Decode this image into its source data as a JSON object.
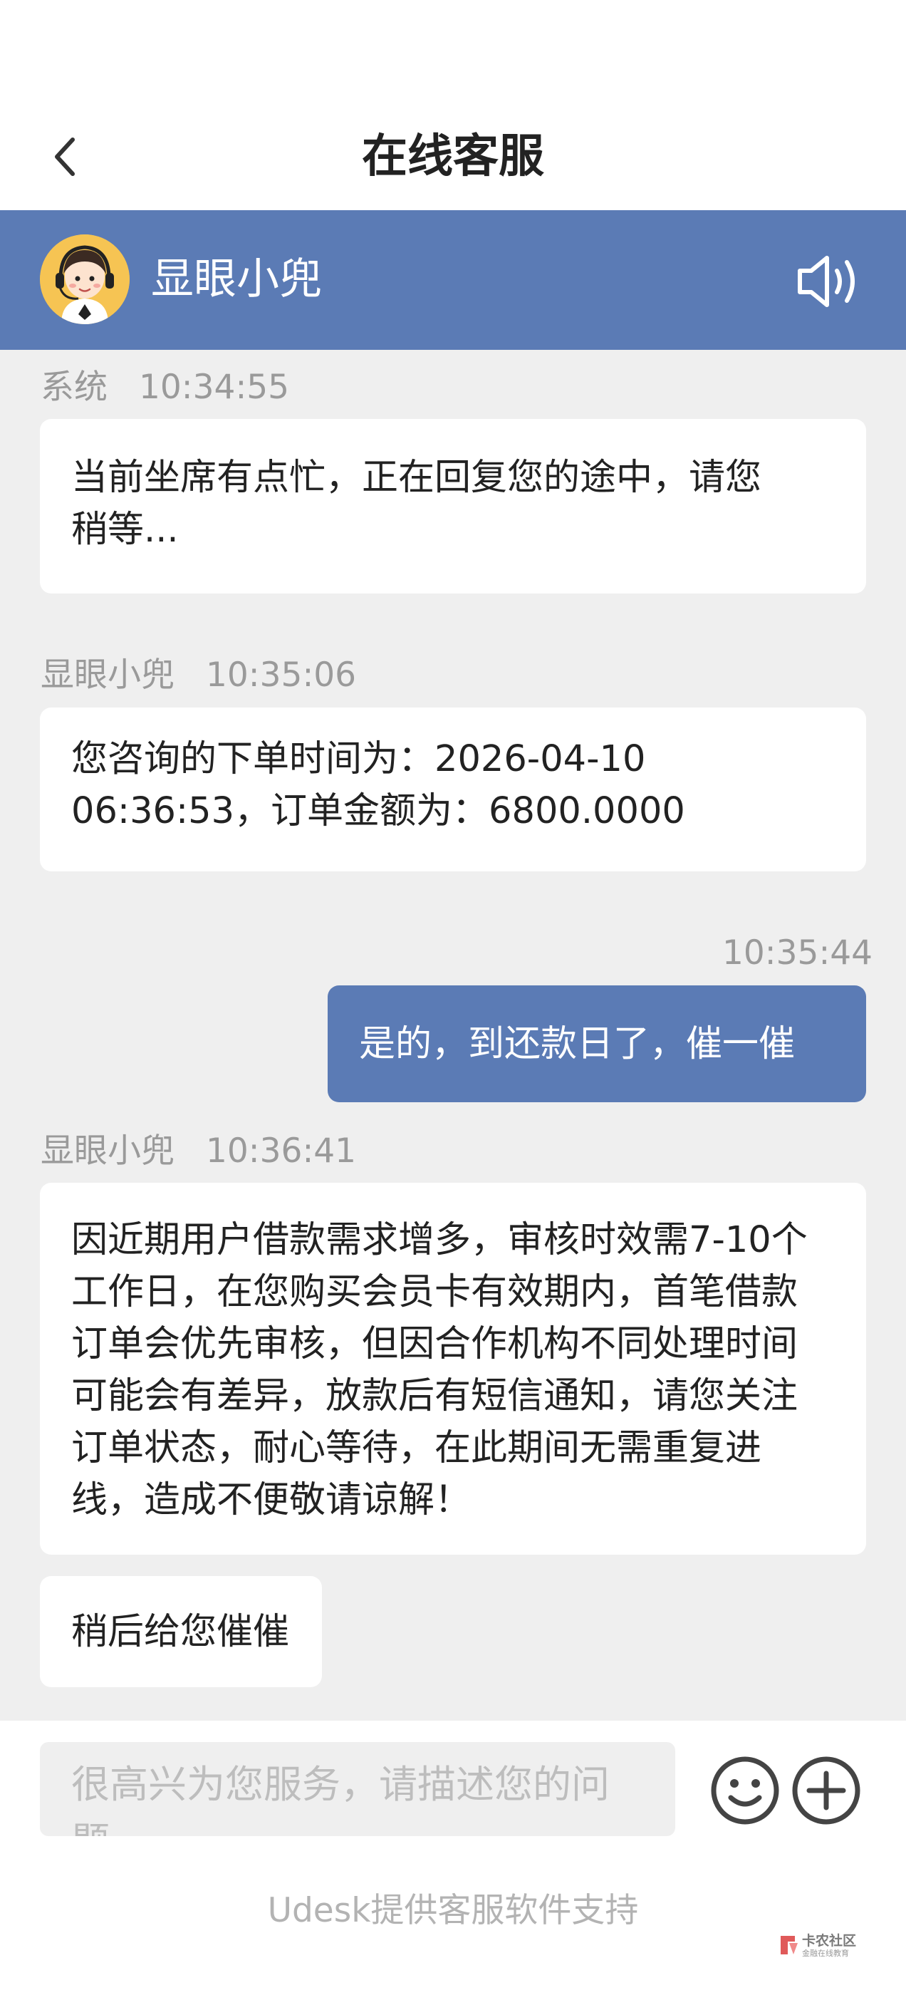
{
  "header": {
    "title": "在线客服"
  },
  "agent": {
    "name": "显眼小兜"
  },
  "messages": [
    {
      "sender": "系统",
      "time": "10:34:55",
      "lines": [
        "当前坐席有点忙，正在回复您的途中，请您",
        "稍等..."
      ]
    },
    {
      "sender": "显眼小兜",
      "time": "10:35:06",
      "lines": [
        "您咨询的下单时间为：2026-04-10",
        "06:36:53，订单金额为：6800.0000"
      ]
    },
    {
      "sender": "",
      "time": "10:35:44",
      "lines": [
        "是的，到还款日了，催一催"
      ]
    },
    {
      "sender": "显眼小兜",
      "time": "10:36:41",
      "lines": [
        "因近期用户借款需求增多，审核时效需7-10个",
        "工作日，在您购买会员卡有效期内，首笔借款",
        "订单会优先审核，但因合作机构不同处理时间",
        "可能会有差异，放款后有短信通知，请您关注",
        "订单状态，耐心等待，在此期间无需重复进",
        "线，造成不便敬请谅解！"
      ]
    },
    {
      "sender": "",
      "time": "",
      "lines": [
        "稍后给您催催"
      ]
    }
  ],
  "input": {
    "placeholder_lines": [
      "很高兴为您服务，请描述您的问",
      "题"
    ]
  },
  "footer": {
    "powered_by": "Udesk提供客服软件支持"
  },
  "watermark": {
    "text": "卡农社区",
    "sub": "金融在线教育"
  },
  "colors": {
    "accent": "#5b7bb5",
    "background": "#efefef"
  }
}
